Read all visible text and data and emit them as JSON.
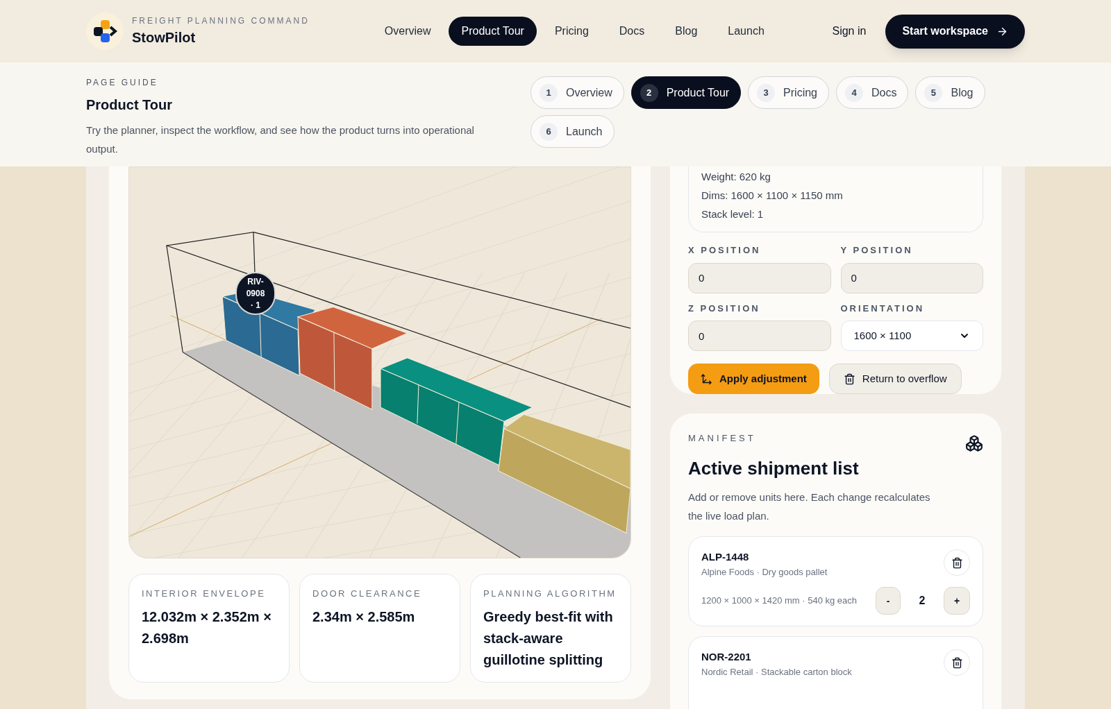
{
  "brand": {
    "eyebrow": "FREIGHT PLANNING COMMAND",
    "name": "StowPilot"
  },
  "nav": [
    {
      "label": "Overview",
      "selected": false
    },
    {
      "label": "Product Tour",
      "selected": true
    },
    {
      "label": "Pricing",
      "selected": false
    },
    {
      "label": "Docs",
      "selected": false
    },
    {
      "label": "Blog",
      "selected": false
    },
    {
      "label": "Launch",
      "selected": false
    }
  ],
  "sign_in": "Sign in",
  "cta": "Start workspace",
  "guide": {
    "eyebrow": "PAGE GUIDE",
    "title": "Product Tour",
    "text": "Try the planner, inspect the workflow, and see how the product turns into operational output.",
    "steps": [
      {
        "number": "1",
        "label": "Overview",
        "selected": false
      },
      {
        "number": "2",
        "label": "Product Tour",
        "selected": true
      },
      {
        "number": "3",
        "label": "Pricing",
        "selected": false
      },
      {
        "number": "4",
        "label": "Docs",
        "selected": false
      },
      {
        "number": "5",
        "label": "Blog",
        "selected": false
      },
      {
        "number": "6",
        "label": "Launch",
        "selected": false
      }
    ]
  },
  "viewer": {
    "badge": "RIV-0908 · 1"
  },
  "stats": [
    {
      "label": "INTERIOR ENVELOPE",
      "value": "12.032m × 2.352m × 2.698m"
    },
    {
      "label": "DOOR CLEARANCE",
      "value": "2.34m × 2.585m"
    },
    {
      "label": "PLANNING ALGORITHM",
      "value": "Greedy best-fit with stack-aware guillotine splitting"
    }
  ],
  "unit_details": [
    "Weight: 620 kg",
    "Dims: 1600 × 1100 × 1150 mm",
    "Stack level: 1"
  ],
  "fields": [
    {
      "label": "X POSITION",
      "kind": "input",
      "value": "0"
    },
    {
      "label": "Y POSITION",
      "kind": "input",
      "value": "0"
    },
    {
      "label": "Z POSITION",
      "kind": "input",
      "value": "0"
    },
    {
      "label": "ORIENTATION",
      "kind": "select",
      "value": "1600 × 1100"
    }
  ],
  "apply_button": "Apply adjustment",
  "overflow_button": "Return to overflow",
  "manifest": {
    "eyebrow": "MANIFEST",
    "title": "Active shipment list",
    "text": "Add or remove units here. Each change recalculates the live load plan.",
    "items": [
      {
        "code": "ALP-1448",
        "subtitle": "Alpine Foods · Dry goods pallet",
        "specs": "1200 × 1000 × 1420 mm · 540 kg each",
        "quantity": "2",
        "decrease": "-",
        "increase": "+"
      },
      {
        "code": "NOR-2201",
        "subtitle": "Nordic Retail · Stackable carton block"
      }
    ]
  }
}
